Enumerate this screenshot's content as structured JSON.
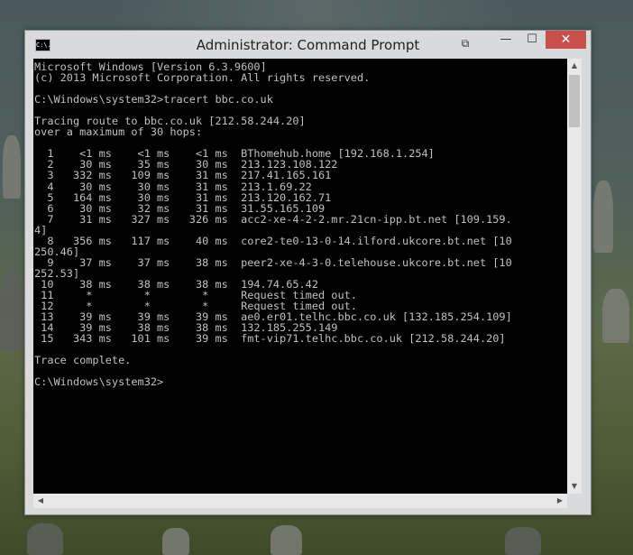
{
  "window": {
    "title": "Administrator: Command Prompt",
    "icon_label": "C:\\.",
    "controls": {
      "quickedit": "⧉",
      "minimize": "—",
      "maximize": "☐",
      "close": "✕"
    }
  },
  "console": {
    "lines": [
      "Microsoft Windows [Version 6.3.9600]",
      "(c) 2013 Microsoft Corporation. All rights reserved.",
      "",
      "C:\\Windows\\system32>tracert bbc.co.uk",
      "",
      "Tracing route to bbc.co.uk [212.58.244.20]",
      "over a maximum of 30 hops:",
      "",
      "  1    <1 ms    <1 ms    <1 ms  BThomehub.home [192.168.1.254]",
      "  2    30 ms    35 ms    30 ms  213.123.108.122",
      "  3   332 ms   109 ms    31 ms  217.41.165.161",
      "  4    30 ms    30 ms    31 ms  213.1.69.22",
      "  5   164 ms    30 ms    31 ms  213.120.162.71",
      "  6    30 ms    32 ms    31 ms  31.55.165.109",
      "  7    31 ms   327 ms   326 ms  acc2-xe-4-2-2.mr.21cn-ipp.bt.net [109.159.",
      "4]",
      "  8   356 ms   117 ms    40 ms  core2-te0-13-0-14.ilford.ukcore.bt.net [10",
      "250.46]",
      "  9    37 ms    37 ms    38 ms  peer2-xe-4-3-0.telehouse.ukcore.bt.net [10",
      "252.53]",
      " 10    38 ms    38 ms    38 ms  194.74.65.42",
      " 11     *        *        *     Request timed out.",
      " 12     *        *        *     Request timed out.",
      " 13    39 ms    39 ms    39 ms  ae0.er01.telhc.bbc.co.uk [132.185.254.109]",
      " 14    39 ms    38 ms    38 ms  132.185.255.149",
      " 15   343 ms   101 ms    39 ms  fmt-vip71.telhc.bbc.co.uk [212.58.244.20]",
      "",
      "Trace complete.",
      "",
      "C:\\Windows\\system32>"
    ]
  },
  "scrollbars": {
    "up": "▲",
    "down": "▼",
    "left": "◀",
    "right": "▶"
  }
}
